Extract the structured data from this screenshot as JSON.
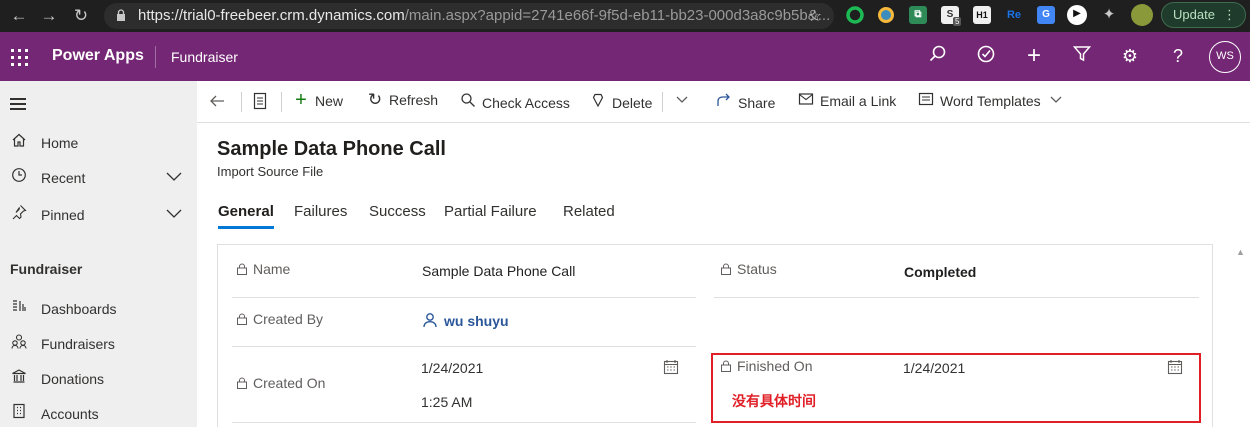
{
  "browser": {
    "url_main": "https://trial0-freebeer.crm.dynamics.com",
    "url_rest": "/main.aspx?appid=2741e66f-9f5d-eb11-bb23-000d3a8c9b5b&...",
    "update_label": "Update",
    "extensions": [
      "S",
      "5",
      "H1",
      "Re"
    ]
  },
  "header": {
    "brand": "Power Apps",
    "app_name": "Fundraiser",
    "user_initials": "WS"
  },
  "sidebar": {
    "items": [
      {
        "label": "Home"
      },
      {
        "label": "Recent"
      },
      {
        "label": "Pinned"
      }
    ],
    "section_title": "Fundraiser",
    "section_items": [
      {
        "label": "Dashboards"
      },
      {
        "label": "Fundraisers"
      },
      {
        "label": "Donations"
      },
      {
        "label": "Accounts"
      }
    ]
  },
  "commands": {
    "new": "New",
    "refresh": "Refresh",
    "check_access": "Check Access",
    "delete": "Delete",
    "share": "Share",
    "email_link": "Email a Link",
    "word_templates": "Word Templates"
  },
  "record": {
    "title": "Sample Data Phone Call",
    "subtitle": "Import Source File"
  },
  "tabs": [
    "General",
    "Failures",
    "Success",
    "Partial Failure",
    "Related"
  ],
  "fields": {
    "name_label": "Name",
    "name_value": "Sample Data Phone Call",
    "status_label": "Status",
    "status_value": "Completed",
    "created_by_label": "Created By",
    "created_by_value": "wu shuyu",
    "created_on_label": "Created On",
    "created_on_date": "1/24/2021",
    "created_on_time": "1:25 AM",
    "finished_on_label": "Finished On",
    "finished_on_date": "1/24/2021"
  },
  "annotation": {
    "note": "没有具体时间",
    "color": "#e01f26"
  },
  "colors": {
    "header": "#742774",
    "accent": "#0078d4"
  }
}
